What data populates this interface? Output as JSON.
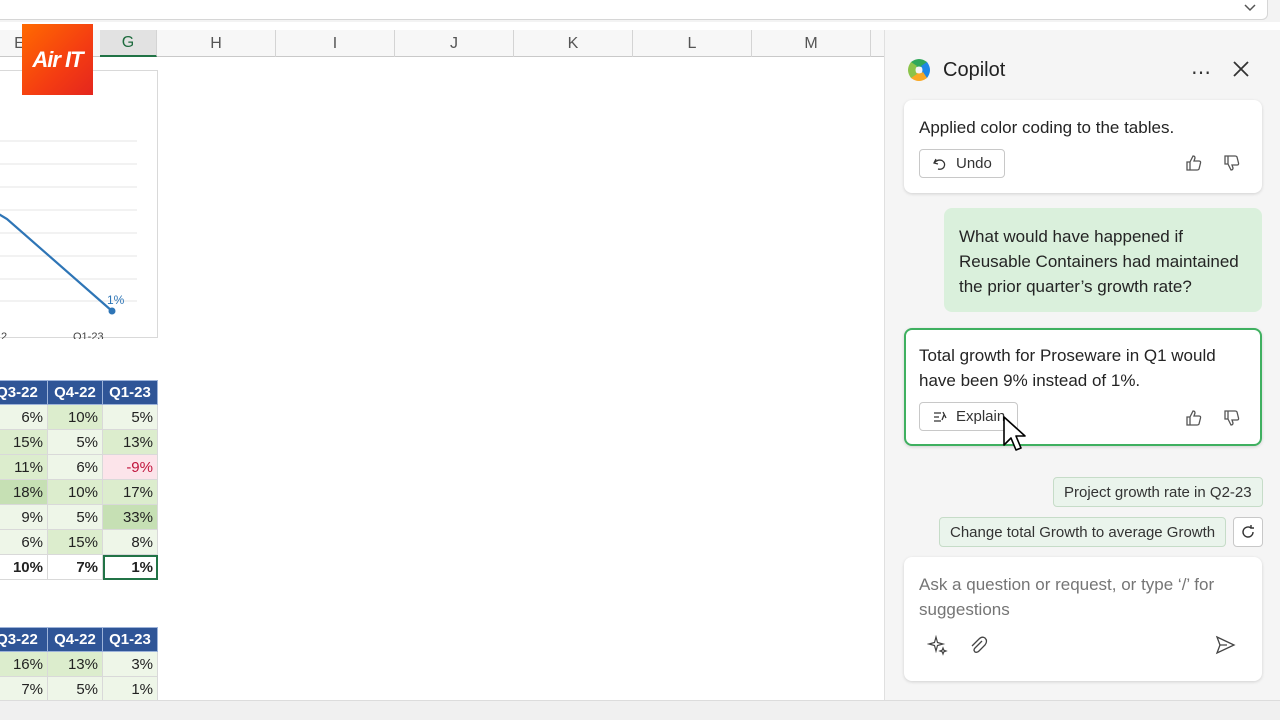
{
  "sheet": {
    "columns": [
      "E",
      "G",
      "H",
      "I",
      "J",
      "K",
      "L",
      "M"
    ],
    "selected_column": "G",
    "logo_text": "Air IT",
    "chart": {
      "data_label": "1%",
      "x_labels": [
        "2",
        "Q1-23"
      ]
    },
    "table1": {
      "headers": [
        "Q3-22",
        "Q4-22",
        "Q1-23"
      ],
      "rows": [
        [
          "6%",
          "10%",
          "5%"
        ],
        [
          "15%",
          "5%",
          "13%"
        ],
        [
          "11%",
          "6%",
          "-9%"
        ],
        [
          "18%",
          "10%",
          "17%"
        ],
        [
          "9%",
          "5%",
          "33%"
        ],
        [
          "6%",
          "15%",
          "8%"
        ]
      ],
      "total": [
        "10%",
        "7%",
        "1%"
      ]
    },
    "table2": {
      "headers": [
        "Q3-22",
        "Q4-22",
        "Q1-23"
      ],
      "rows": [
        [
          "16%",
          "13%",
          "3%"
        ],
        [
          "7%",
          "5%",
          "1%"
        ]
      ]
    }
  },
  "chart_data": {
    "type": "line",
    "x": [
      "2",
      "Q1-23"
    ],
    "series": [
      {
        "values": [
          null,
          1
        ]
      }
    ],
    "annotations": [
      "1%"
    ]
  },
  "copilot": {
    "title": "Copilot",
    "messages": {
      "assistant_1": "Applied color coding to the tables.",
      "undo_label": "Undo",
      "user_1": "What would have happened if Reusable Containers had maintained the prior quarter’s growth rate?",
      "assistant_2": "Total growth for Proseware in Q1 would have been 9% instead of 1%.",
      "explain_label": "Explain"
    },
    "suggestions": [
      "Project growth rate in Q2-23",
      "Change total Growth to average Growth"
    ],
    "input_placeholder": "Ask a question or request, or type ‘/’ for suggestions"
  },
  "colors": {
    "accent_green": "#217346",
    "header_blue": "#2f5597",
    "line_blue": "#2e75b6",
    "bubble_green": "#daf0dc"
  }
}
